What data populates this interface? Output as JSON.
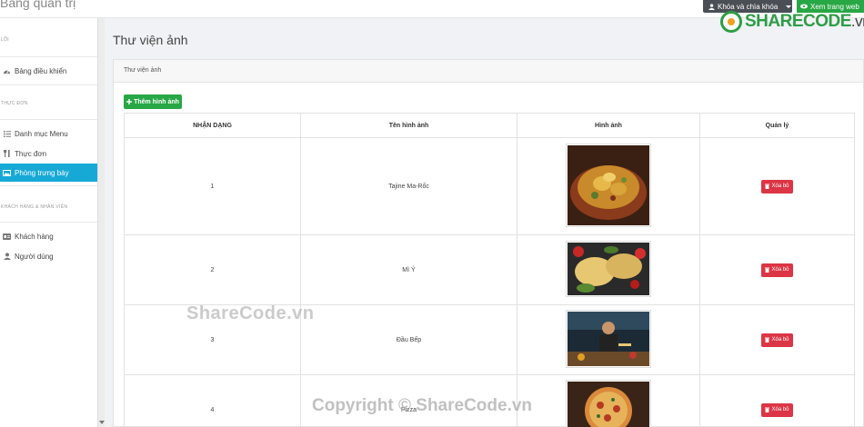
{
  "topbar": {
    "brand": "Bảng quản trị",
    "lock_button": "Khóa và chìa khóa",
    "view_button": "Xem trang web"
  },
  "logo": {
    "main": "SHARECODE",
    "suffix": ".vn"
  },
  "sidebar": {
    "sections": [
      {
        "heading": "LÕI",
        "items": [
          {
            "label": "Bảng điều khiển",
            "icon": "dashboard-icon"
          }
        ]
      },
      {
        "heading": "THỰC ĐƠN",
        "items": [
          {
            "label": "Danh mục Menu",
            "icon": "list-icon"
          },
          {
            "label": "Thực đơn",
            "icon": "utensils-icon"
          },
          {
            "label": "Phòng trưng bày",
            "icon": "image-icon",
            "active": true
          }
        ]
      },
      {
        "heading": "KHÁCH HÀNG & NHÂN VIÊN",
        "items": [
          {
            "label": "Khách hàng",
            "icon": "id-card-icon"
          },
          {
            "label": "Người dùng",
            "icon": "user-icon"
          }
        ]
      }
    ]
  },
  "main": {
    "page_title": "Thư viện ảnh",
    "card_title": "Thư viện ảnh",
    "add_button": "Thêm hình ảnh",
    "table": {
      "headers": [
        "NHẬN DẠNG",
        "Tên hình ảnh",
        "Hình ảnh",
        "Quản lý"
      ],
      "rows": [
        {
          "id": "1",
          "name": "Tajine Ma-Rốc",
          "image": "tagine-photo",
          "action": "Xóa bỏ"
        },
        {
          "id": "2",
          "name": "Mì Ý",
          "image": "pasta-photo",
          "action": "Xóa bỏ"
        },
        {
          "id": "3",
          "name": "Đầu Bếp",
          "image": "chef-photo",
          "action": "Xóa bỏ"
        },
        {
          "id": "4",
          "name": "Pizza",
          "image": "pizza-photo",
          "action": "Xóa bỏ"
        }
      ]
    }
  },
  "watermarks": {
    "center": "ShareCode.vn",
    "copyright": "Copyright © ShareCode.vn"
  },
  "colors": {
    "active": "#17a9d6",
    "success": "#28a745",
    "danger": "#dc3545",
    "dark": "#4a4f55"
  }
}
